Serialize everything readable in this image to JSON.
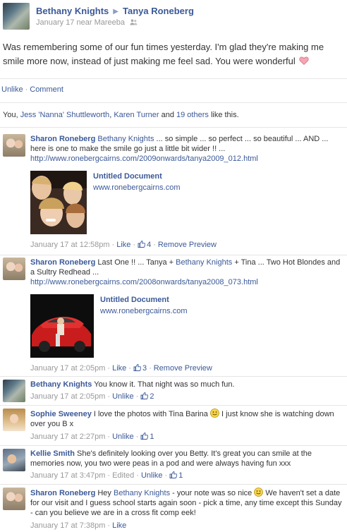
{
  "header": {
    "from_name": "Bethany Knights",
    "to_name": "Tanya Roneberg",
    "date": "January 17",
    "location": "near Mareeba"
  },
  "status_text": "Was remembering some of our fun times yesterday. I'm glad they're making me smile more now, instead of just making me feel sad. You were wonderful",
  "actions": {
    "unlike": "Unlike",
    "comment": "Comment"
  },
  "likes": {
    "prefix": "You,",
    "name1": "Jess 'Nanna' Shuttleworth",
    "comma": ",",
    "name2": "Karen Turner",
    "and": "and",
    "others": "19 others",
    "suffix": "like this."
  },
  "comments": [
    {
      "author": "Sharon Roneberg",
      "tag": "Bethany Knights",
      "text": "... so simple ... so perfect ... so beautiful ... AND ... here is one to make the smile go just a little bit wider !! ...",
      "link": "http://www.ronebergcairns.com/2009onwards/tanya2009_012.html",
      "preview_title": "Untitled Document",
      "preview_url": "www.ronebergcairns.com",
      "time": "January 17 at 12:58pm",
      "like": "Like",
      "like_count": "4",
      "remove": "Remove Preview"
    },
    {
      "author": "Sharon Roneberg",
      "text_a": "Last One !! ... Tanya +",
      "tag": "Bethany Knights",
      "text_b": "+ Tina ... Two Hot Blondes and a Sultry Redhead ...",
      "link": "http://www.ronebergcairns.com/2008onwards/tanya2008_073.html",
      "preview_title": "Untitled Document",
      "preview_url": "www.ronebergcairns.com",
      "time": "January 17 at 2:05pm",
      "like": "Like",
      "like_count": "3",
      "remove": "Remove Preview"
    },
    {
      "author": "Bethany Knights",
      "text": "You know it. That night was so much fun.",
      "time": "January 17 at 2:05pm",
      "unlike": "Unlike",
      "like_count": "2"
    },
    {
      "author": "Sophie Sweeney",
      "text_a": "I love the photos with Tina Barina",
      "text_b": "I just know she is watching down over you B x",
      "time": "January 17 at 2:27pm",
      "unlike": "Unlike",
      "like_count": "1"
    },
    {
      "author": "Kellie Smith",
      "text": "She's definitely looking over you Betty. It's great you can smile at the memories now, you two were peas in a pod and were always having fun xxx",
      "time": "January 17 at 3:47pm",
      "edited": "Edited",
      "unlike": "Unlike",
      "like_count": "1"
    },
    {
      "author": "Sharon Roneberg",
      "text_a": "Hey",
      "tag": "Bethany Knights",
      "text_b": "- your note was so nice",
      "text_c": "We haven't set a date for our visit and I guess school starts again soon - pick a time, any time except this Sunday - can you believe we are in a cross fit comp eek!",
      "time": "January 17 at 7:38pm",
      "like": "Like"
    }
  ],
  "icons": {
    "arrow": "right-triangle-icon",
    "friends": "friends-icon",
    "heart": "heart-icon",
    "thumb": "thumbs-up-icon",
    "smiley": "smiley-icon"
  },
  "colors": {
    "link": "#3b5998",
    "muted": "#999999",
    "heart": "#e25c6f"
  }
}
